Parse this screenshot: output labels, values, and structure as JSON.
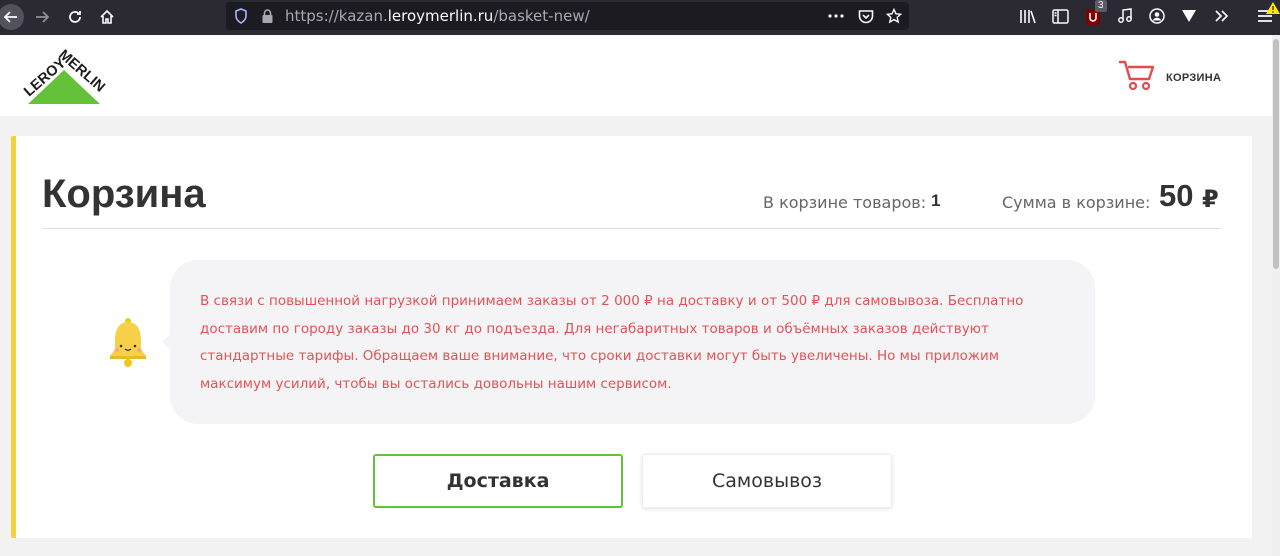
{
  "browser": {
    "url_prefix": "https://kazan.",
    "url_host": "leroymerlin.ru",
    "url_path": "/basket-new/",
    "ublock_count": "3"
  },
  "header": {
    "logo_text_top": "MERLIN",
    "logo_text_left": "LEROY",
    "cart_label": "КОРЗИНА"
  },
  "basket": {
    "title": "Корзина",
    "count_label": "В корзине товаров:",
    "count_value": "1",
    "sum_label": "Сумма в корзине:",
    "sum_value": "50",
    "currency": "₽"
  },
  "notice": {
    "text": "В связи с повышенной нагрузкой принимаем заказы от 2 000 ₽ на доставку и от 500 ₽ для самовывоза. Бесплатно доставим по городу заказы до 30 кг до подъезда. Для негабаритных товаров и объёмных заказов действуют стандартные тарифы. Обращаем ваше внимание, что сроки доставки могут быть увеличены. Но мы приложим максимум усилий, чтобы вы остались довольны нашим сервисом."
  },
  "delivery_tabs": [
    {
      "label": "Доставка",
      "selected": true
    },
    {
      "label": "Самовывоз",
      "selected": false
    }
  ],
  "colors": {
    "brand_green": "#66c13a",
    "accent_yellow": "#f2d33d",
    "notice_red": "#e35255",
    "cart_red": "#e24c4b"
  }
}
